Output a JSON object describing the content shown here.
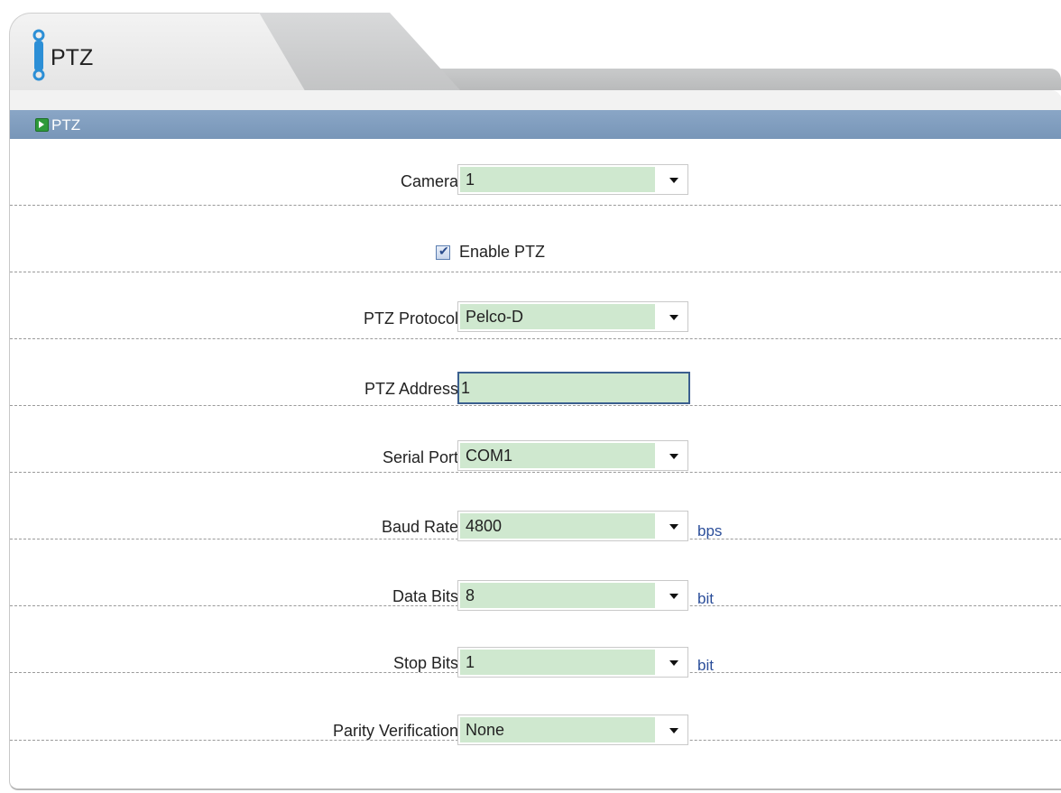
{
  "tab": {
    "title": "PTZ",
    "icon": "ptz-icon"
  },
  "section": {
    "title": "PTZ",
    "icon": "arrow-right-icon"
  },
  "form": {
    "camera": {
      "label": "Camera:",
      "value": "1"
    },
    "enable_ptz": {
      "label": "Enable PTZ",
      "checked": true
    },
    "ptz_protocol": {
      "label": "PTZ Protocol:",
      "value": "Pelco-D"
    },
    "ptz_address": {
      "label": "PTZ Address:",
      "value": "1"
    },
    "serial_port": {
      "label": "Serial Port:",
      "value": "COM1"
    },
    "baud_rate": {
      "label": "Baud Rate:",
      "value": "4800",
      "unit": "bps"
    },
    "data_bits": {
      "label": "Data Bits:",
      "value": "8",
      "unit": "bit"
    },
    "stop_bits": {
      "label": "Stop Bits:",
      "value": "1",
      "unit": "bit"
    },
    "parity": {
      "label": "Parity Verification:",
      "value": "None"
    }
  },
  "colors": {
    "section_bar": "#7f9cbf",
    "field_bg": "#cfe8cf",
    "unit_text": "#2b4e9a"
  }
}
